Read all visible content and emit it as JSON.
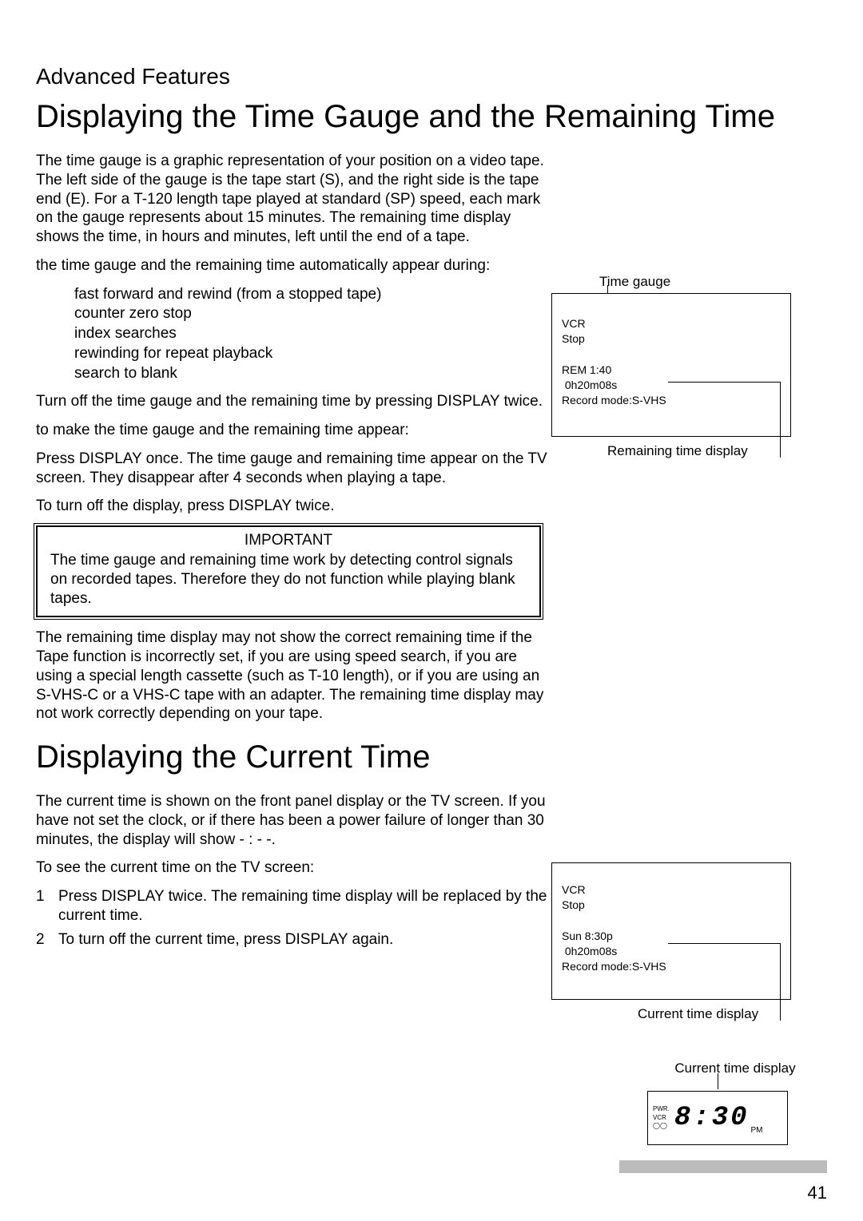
{
  "section": "Advanced Features",
  "title1": "Displaying the Time Gauge and the Remaining Time",
  "para1": "The time gauge is a graphic representation of your position on a video tape.  The left side of the gauge is the tape start (S), and the right side is the tape end (E).  For a T-120 length tape played at standard (SP) speed, each mark on the gauge represents about 15 minutes.  The remaining time display shows the time, in hours and minutes, left until the end of a tape.",
  "para2": "the time gauge and the remaining time automatically appear during:",
  "list": {
    "i1": "fast forward and rewind (from a stopped tape)",
    "i2": "counter zero stop",
    "i3": "index searches",
    "i4": "rewinding for repeat playback",
    "i5": "search to blank"
  },
  "para3": "Turn off the time gauge and the remaining time by pressing DISPLAY twice.",
  "para4": "to make the time gauge and the remaining time appear:",
  "para5": "Press DISPLAY once.  The time gauge and remaining time appear on the TV screen.  They disappear after 4 seconds when playing a tape.",
  "para6": "To turn off the display, press DISPLAY twice.",
  "important": {
    "title": "IMPORTANT",
    "text": "The time gauge and remaining time work by detecting control signals on recorded tapes.  Therefore they do not function while playing blank tapes."
  },
  "para7": "The remaining time display may not show the correct remaining time if the Tape function is incorrectly set, if you are using speed search, if you are using a special length cassette (such as T-10 length), or if you are using an S-VHS-C or a VHS-C tape with an adapter. The remaining time display may not work correctly depending on your tape.",
  "title2": "Displaying the Current Time",
  "para8": "The current time is shown on the front panel display or the TV screen.  If you have not set the clock, or if there has been a power failure of longer than 30 minutes, the display will show - : - -.",
  "para9": "To see the current time on the TV screen:",
  "ol": {
    "n1": "1",
    "t1": "Press DISPLAY twice.  The remaining time display will be replaced by the current time.",
    "n2": "2",
    "t2": "To turn off the current time, press DISPLAY again."
  },
  "fig1": {
    "top_caption": "Time gauge",
    "l1": "VCR",
    "l2": "Stop",
    "l3": "REM  1:40",
    "l4": " 0h20m08s",
    "l5": "Record mode:S-VHS",
    "bottom_caption": "Remaining time display"
  },
  "fig2": {
    "l1": "VCR",
    "l2": "Stop",
    "l3": "Sun  8:30p",
    "l4": " 0h20m08s",
    "l5": "Record mode:S-VHS",
    "bottom_caption": "Current time display"
  },
  "fig3": {
    "caption": "Current time display",
    "pwr": "PWR.",
    "vcr": "VCR",
    "tape": "◯◯",
    "time": "8:30",
    "pm": "PM"
  },
  "page_number": "41"
}
